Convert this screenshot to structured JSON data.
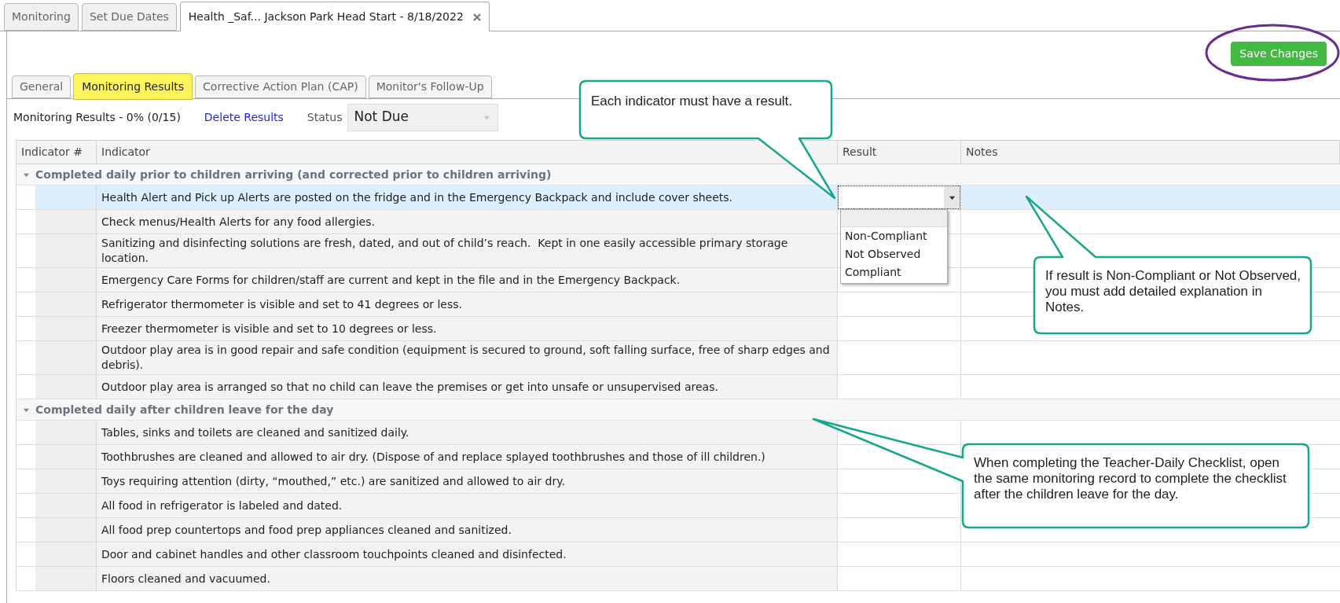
{
  "document_tabs": [
    {
      "label": "Monitoring",
      "selected": false,
      "closable": false
    },
    {
      "label": "Set Due Dates",
      "selected": false,
      "closable": false
    },
    {
      "label": "Health _Saf... Jackson Park Head Start - 8/18/2022",
      "selected": true,
      "closable": true
    }
  ],
  "save_button": "Save Changes",
  "section_tabs": [
    {
      "label": "General",
      "selected": false
    },
    {
      "label": "Monitoring Results",
      "selected": true
    },
    {
      "label": "Corrective Action Plan (CAP)",
      "selected": false
    },
    {
      "label": "Monitor's Follow-Up",
      "selected": false
    }
  ],
  "toolbar": {
    "progress": "Monitoring Results - 0% (0/15)",
    "delete_link": "Delete Results",
    "status_label": "Status",
    "status_value": "Not Due",
    "status_disabled": true
  },
  "table": {
    "columns": [
      "Indicator #",
      "Indicator",
      "Result",
      "Notes"
    ],
    "groups": [
      {
        "title": "Completed daily prior to children arriving (and corrected prior to children arriving)",
        "expanded": true,
        "rows": [
          {
            "indicator": "Health Alert and Pick up Alerts are posted on the fridge and in the Emergency Backpack and include cover sheets.",
            "selected": true
          },
          {
            "indicator": "Check menus/Health Alerts for any food allergies.",
            "selected": false
          },
          {
            "indicator": "Sanitizing and disinfecting solutions are fresh, dated, and out of child’s reach.  Kept in one easily accessible primary storage location.",
            "selected": false
          },
          {
            "indicator": "Emergency Care Forms for children/staff are current and kept in the file and in the Emergency Backpack.",
            "selected": false
          },
          {
            "indicator": "Refrigerator thermometer is visible and set to 41 degrees or less.",
            "selected": false
          },
          {
            "indicator": "Freezer thermometer is visible and set to 10 degrees or less.",
            "selected": false
          },
          {
            "indicator": "Outdoor play area is in good repair and safe condition (equipment is secured to ground, soft falling surface, free of sharp edges and debris).",
            "selected": false
          },
          {
            "indicator": "Outdoor play area is arranged so that no child can leave the premises or get into unsafe or unsupervised areas.",
            "selected": false
          }
        ]
      },
      {
        "title": "Completed daily after children leave for the day",
        "expanded": true,
        "rows": [
          {
            "indicator": "Tables, sinks and toilets are cleaned and sanitized daily.",
            "selected": false
          },
          {
            "indicator": "Toothbrushes are cleaned and allowed to air dry. (Dispose of and replace splayed toothbrushes and those of ill children.)",
            "selected": false
          },
          {
            "indicator": "Toys requiring attention (dirty, “mouthed,” etc.) are sanitized and allowed to air dry.",
            "selected": false
          },
          {
            "indicator": "All food in refrigerator is labeled and dated.",
            "selected": false
          },
          {
            "indicator": "All food prep countertops and food prep appliances cleaned and sanitized.",
            "selected": false
          },
          {
            "indicator": "Door and cabinet handles and other classroom touchpoints cleaned and disinfected.",
            "selected": false
          },
          {
            "indicator": "Floors cleaned and vacuumed.",
            "selected": false
          }
        ]
      }
    ]
  },
  "result_dropdown": {
    "open": true,
    "options": [
      "Non-Compliant",
      "Not Observed",
      "Compliant"
    ]
  },
  "callouts": [
    {
      "text": "Each indicator must have a result."
    },
    {
      "text": "If result is Non-Compliant or Not Observed, you must add detailed explanation in Notes."
    },
    {
      "text": "When completing the Teacher-Daily Checklist, open the same monitoring record to complete the checklist after the children leave for the day."
    }
  ]
}
